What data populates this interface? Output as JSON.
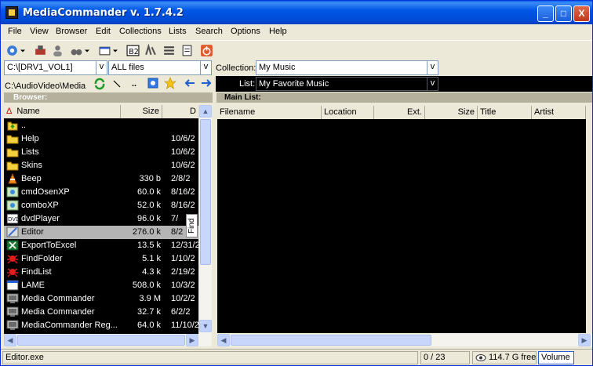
{
  "window": {
    "title": "MediaCommander v. 1.7.4.2",
    "minimize": "_",
    "maximize": "□",
    "close": "X"
  },
  "menu": [
    "File",
    "View",
    "Browser",
    "Edit",
    "Collections",
    "Lists",
    "Search",
    "Options",
    "Help"
  ],
  "toolbar": {
    "icons": [
      "settings-icon",
      "disk-icon",
      "users-icon",
      "binoculars-icon",
      "window-icon",
      "b2-icon",
      "dvd-icon",
      "list-icon",
      "book-icon",
      "power-icon"
    ]
  },
  "browser": {
    "drive": "C:\\[DRV1_VOL1]",
    "filter": "ALL files",
    "path": "C:\\AudioVideo\\Media",
    "nav": {
      "up": ".."
    },
    "header": "Browser:",
    "columns": [
      "Name",
      "Size",
      "D"
    ],
    "sort_marker": "Δ",
    "rows": [
      {
        "icon": "up-folder-icon",
        "name": "..",
        "size": "",
        "date": ""
      },
      {
        "icon": "folder-icon",
        "name": "Help",
        "size": "",
        "date": "10/6/2"
      },
      {
        "icon": "folder-icon",
        "name": "Lists",
        "size": "",
        "date": "10/6/2"
      },
      {
        "icon": "folder-icon",
        "name": "Skins",
        "size": "",
        "date": "10/6/2"
      },
      {
        "icon": "cone-icon",
        "name": "Beep",
        "size": "330 b",
        "date": "2/8/2"
      },
      {
        "icon": "app-icon",
        "name": "cmdOsenXP",
        "size": "60.0 k",
        "date": "8/16/2"
      },
      {
        "icon": "app-icon",
        "name": "comboXP",
        "size": "52.0 k",
        "date": "8/16/2"
      },
      {
        "icon": "dvd-icon",
        "name": "dvdPlayer",
        "size": "96.0 k",
        "date": "7/"
      },
      {
        "icon": "editor-icon",
        "name": "Editor",
        "size": "276.0 k",
        "date": "8/2"
      },
      {
        "icon": "excel-icon",
        "name": "ExportToExcel",
        "size": "13.5 k",
        "date": "12/31/2"
      },
      {
        "icon": "bug-icon",
        "name": "FindFolder",
        "size": "5.1 k",
        "date": "1/10/2"
      },
      {
        "icon": "bug-icon",
        "name": "FindList",
        "size": "4.3 k",
        "date": "2/19/2"
      },
      {
        "icon": "lame-icon",
        "name": "LAME",
        "size": "508.0 k",
        "date": "10/3/2"
      },
      {
        "icon": "monitor-icon",
        "name": "Media Commander",
        "size": "3.9 M",
        "date": "10/2/2"
      },
      {
        "icon": "monitor-icon",
        "name": "Media Commander",
        "size": "32.7 k",
        "date": "6/2/2"
      },
      {
        "icon": "monitor-icon",
        "name": "MediaCommander Reg...",
        "size": "64.0 k",
        "date": "11/10/2"
      }
    ],
    "selected_index": 8,
    "find_tab": "Find"
  },
  "collection": {
    "collection_label": "Collection:",
    "collection_value": "My Music",
    "list_label": "List:",
    "list_value": "My Favorite Music",
    "header": "Main List:",
    "columns": [
      "Filename",
      "Location",
      "Ext.",
      "Size",
      "Title",
      "Artist"
    ]
  },
  "status": {
    "file": "Editor.exe",
    "count": "0 / 23",
    "free": "114.7 G free",
    "volume": "Volume"
  },
  "colors": {
    "title_blue": "#0058e6",
    "list_bg": "#000000",
    "header_tan": "#b4b09c",
    "browser_header_text": "#ffffff"
  }
}
